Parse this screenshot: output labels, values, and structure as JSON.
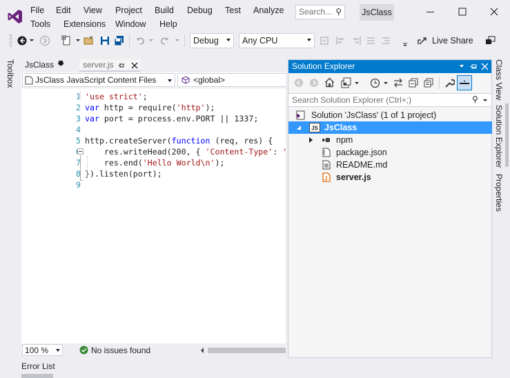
{
  "menu": {
    "file": "File",
    "edit": "Edit",
    "view": "View",
    "project": "Project",
    "build": "Build",
    "debug": "Debug",
    "test": "Test",
    "analyze": "Analyze",
    "tools": "Tools",
    "extensions": "Extensions",
    "window": "Window",
    "help": "Help"
  },
  "search": {
    "placeholder": "Search..."
  },
  "solution_name": "JsClass",
  "toolbar": {
    "config": "Debug",
    "platform": "Any CPU",
    "live_share": "Live Share"
  },
  "side_tabs": {
    "toolbox": "Toolbox",
    "class_view": "Class View",
    "solution_explorer": "Solution Explorer",
    "properties": "Properties"
  },
  "doc_tabs": [
    {
      "label": "JsClass"
    },
    {
      "label": "server.js"
    }
  ],
  "editor": {
    "project_combo": "JsClass JavaScript Content Files",
    "scope_combo": "<global>",
    "lines": [
      {
        "num": "1",
        "tokens": [
          {
            "t": "'use strict'",
            "c": "str"
          },
          {
            "t": ";",
            "c": ""
          }
        ]
      },
      {
        "num": "2",
        "tokens": [
          {
            "t": "var",
            "c": "kw"
          },
          {
            "t": " http = require(",
            "c": ""
          },
          {
            "t": "'http'",
            "c": "str"
          },
          {
            "t": ");",
            "c": ""
          }
        ]
      },
      {
        "num": "3",
        "tokens": [
          {
            "t": "var",
            "c": "kw"
          },
          {
            "t": " port = process.env.PORT || 1337;",
            "c": ""
          }
        ]
      },
      {
        "num": "4",
        "tokens": []
      },
      {
        "num": "5",
        "tokens": [
          {
            "t": "http.createServer(",
            "c": ""
          },
          {
            "t": "function",
            "c": "kw"
          },
          {
            "t": " (req, res) {",
            "c": ""
          }
        ]
      },
      {
        "num": "6",
        "tokens": [
          {
            "t": "    res.writeHead(200, { ",
            "c": ""
          },
          {
            "t": "'Content-Type'",
            "c": "str"
          },
          {
            "t": ": ",
            "c": ""
          },
          {
            "t": "'",
            "c": "str"
          }
        ]
      },
      {
        "num": "7",
        "tokens": [
          {
            "t": "    res.end(",
            "c": ""
          },
          {
            "t": "'Hello World\\n'",
            "c": "str"
          },
          {
            "t": ");",
            "c": ""
          }
        ]
      },
      {
        "num": "8",
        "tokens": [
          {
            "t": "}).listen(port);",
            "c": ""
          }
        ]
      },
      {
        "num": "9",
        "tokens": []
      }
    ],
    "zoom": "100 %",
    "issues": "No issues found"
  },
  "bottom_tab": "Error List",
  "solution_explorer": {
    "title": "Solution Explorer",
    "search_placeholder": "Search Solution Explorer (Ctrl+;)",
    "solution_label": "Solution 'JsClass' (1 of 1 project)",
    "project": "JsClass",
    "items": [
      {
        "label": "npm",
        "icon": "npm-icon"
      },
      {
        "label": "package.json",
        "icon": "json-file-icon"
      },
      {
        "label": "README.md",
        "icon": "markdown-file-icon"
      },
      {
        "label": "server.js",
        "icon": "js-file-icon"
      }
    ]
  },
  "colors": {
    "accent": "#007acc",
    "selection": "#3399ff",
    "vs_purple": "#68217a"
  }
}
